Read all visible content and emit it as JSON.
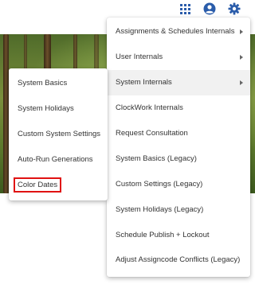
{
  "header": {
    "icons": [
      "apps-grid-icon",
      "account-circle-icon",
      "gear-icon"
    ]
  },
  "main_menu": {
    "items": [
      {
        "label": "Assignments & Schedules Internals",
        "has_submenu": true
      },
      {
        "label": "User Internals",
        "has_submenu": true
      },
      {
        "label": "System Internals",
        "has_submenu": true,
        "active": true
      },
      {
        "label": "ClockWork Internals",
        "has_submenu": false
      },
      {
        "label": "Request Consultation",
        "has_submenu": false
      },
      {
        "label": "System Basics (Legacy)",
        "has_submenu": false
      },
      {
        "label": "Custom Settings (Legacy)",
        "has_submenu": false
      },
      {
        "label": "System Holidays (Legacy)",
        "has_submenu": false
      },
      {
        "label": "Schedule Publish + Lockout",
        "has_submenu": false
      },
      {
        "label": "Adjust Assigncode Conflicts (Legacy)",
        "has_submenu": false
      }
    ]
  },
  "sub_menu": {
    "items": [
      {
        "label": "System Basics"
      },
      {
        "label": "System Holidays"
      },
      {
        "label": "Custom System Settings"
      },
      {
        "label": "Auto-Run Generations"
      },
      {
        "label": "Color Dates",
        "highlighted": true
      }
    ]
  },
  "colors": {
    "highlight_border": "#e01212",
    "header_icon": "#2a5caa",
    "active_row": "#f1f1f1"
  }
}
